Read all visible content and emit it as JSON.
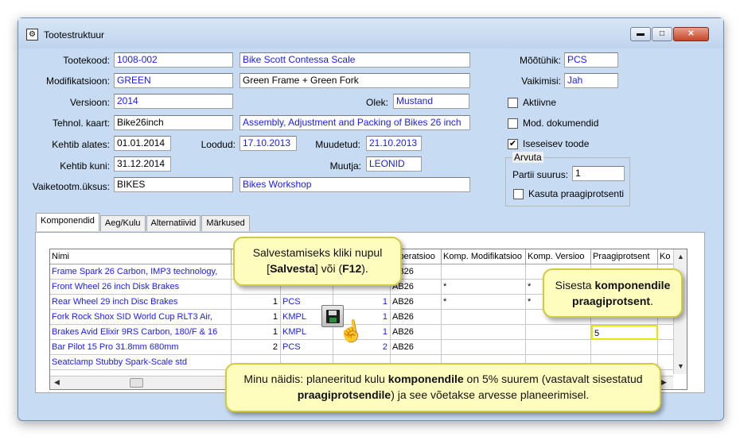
{
  "window": {
    "title": "Tootestruktuur",
    "min_symbol": "▬",
    "max_symbol": "□",
    "close_symbol": "✕"
  },
  "form": {
    "tootekood_label": "Tootekood:",
    "tootekood_value": "1008-002",
    "tootekood_desc": "Bike Scott Contessa Scale",
    "modifikatsioon_label": "Modifikatsioon:",
    "modifikatsioon_value": "GREEN",
    "modifikatsioon_desc": "Green Frame + Green Fork",
    "versioon_label": "Versioon:",
    "versioon_value": "2014",
    "olek_label": "Olek:",
    "olek_value": "Mustand",
    "tehnol_label": "Tehnol. kaart:",
    "tehnol_value": "Bike26inch",
    "tehnol_desc": "Assembly, Adjustment and Packing of Bikes 26 inch",
    "kehtib_alates_label": "Kehtib alates:",
    "kehtib_alates_value": "01.01.2014",
    "loodud_label": "Loodud:",
    "loodud_value": "17.10.2013",
    "muudetud_label": "Muudetud:",
    "muudetud_value": "21.10.2013",
    "kehtib_kuni_label": "Kehtib kuni:",
    "kehtib_kuni_value": "31.12.2014",
    "muutja_label": "Muutja:",
    "muutja_value": "LEONID",
    "vaiketootm_label": "Vaiketootm.üksus:",
    "vaiketootm_value": "BIKES",
    "vaiketootm_desc": "Bikes Workshop",
    "mootuhik_label": "Mõõtühik:",
    "mootuhik_value": "PCS",
    "vaikimisi_label": "Vaikimisi:",
    "vaikimisi_value": "Jah",
    "aktiivne_label": "Aktiivne",
    "mod_dok_label": "Mod. dokumendid",
    "iseseisev_label": "Iseseisev toode",
    "iseseisev_checked": "✔",
    "arvuta_label": "Arvuta",
    "partii_label": "Partii suurus:",
    "partii_value": "1",
    "kasuta_label": "Kasuta praagiprotsenti"
  },
  "tabs": [
    "Komponendid",
    "Aeg/Kulu",
    "Alternatiivid",
    "Märkused"
  ],
  "grid": {
    "headers": {
      "nimi": "Nimi",
      "hidden": "",
      "kogus": "",
      "operatsioon": "Operatsioo",
      "komp_mod": "Komp. Modifikatsioo",
      "komp_ver": "Komp. Versioo",
      "praagi": "Praagiprotsent",
      "ko": "Ko"
    },
    "rows": [
      {
        "nimi": "Frame Spark 26 Carbon, IMP3 technology,",
        "kogus": "",
        "yhik": "",
        "pos": "",
        "op": "AB26",
        "mod": "",
        "ver": "",
        "praagi": ""
      },
      {
        "nimi": "Front Wheel 26 inch Disk Brakes",
        "kogus": "",
        "yhik": "",
        "pos": "",
        "op": "AB26",
        "mod": "*",
        "ver": "*",
        "praagi": ""
      },
      {
        "nimi": "Rear Wheel 29 inch Disc Brakes",
        "kogus": "1",
        "yhik": "PCS",
        "pos": "1",
        "op": "AB26",
        "mod": "*",
        "ver": "*",
        "praagi": ""
      },
      {
        "nimi": "Fork Rock Shox SID World Cup RLT3 Air,",
        "kogus": "1",
        "yhik": "KMPL",
        "pos": "1",
        "op": "AB26",
        "mod": "",
        "ver": "",
        "praagi": ""
      },
      {
        "nimi": "Brakes Avid Elixir 9RS Carbon, 180/F & 16",
        "kogus": "1",
        "yhik": "KMPL",
        "pos": "1",
        "op": "AB26",
        "mod": "",
        "ver": "",
        "praagi": "5"
      },
      {
        "nimi": "Bar Pilot 15 Pro 31.8mm 680mm",
        "kogus": "2",
        "yhik": "PCS",
        "pos": "2",
        "op": "AB26",
        "mod": "",
        "ver": "",
        "praagi": ""
      },
      {
        "nimi": "Seatclamp Stubby Spark-Scale std",
        "kogus": "",
        "yhik": "",
        "pos": "",
        "op": "",
        "mod": "",
        "ver": "",
        "praagi": ""
      }
    ]
  },
  "callouts": {
    "save": {
      "pre": "Salvestamiseks kliki nupul [",
      "b1": "Salvesta",
      "mid": "] või (",
      "b2": "F12",
      "post": ")."
    },
    "komp": {
      "pre": "Sisesta ",
      "b1": "komponendile",
      "b2": "praagiprotsent",
      "post": "."
    },
    "bottom": {
      "pre": "Minu näidis: planeeritud kulu ",
      "b1": "komponendile",
      "mid": " on 5% suurem (vastavalt sisestatud ",
      "b2": "praagiprotsendile",
      "post": ") ja see võetakse arvesse planeerimisel."
    }
  }
}
